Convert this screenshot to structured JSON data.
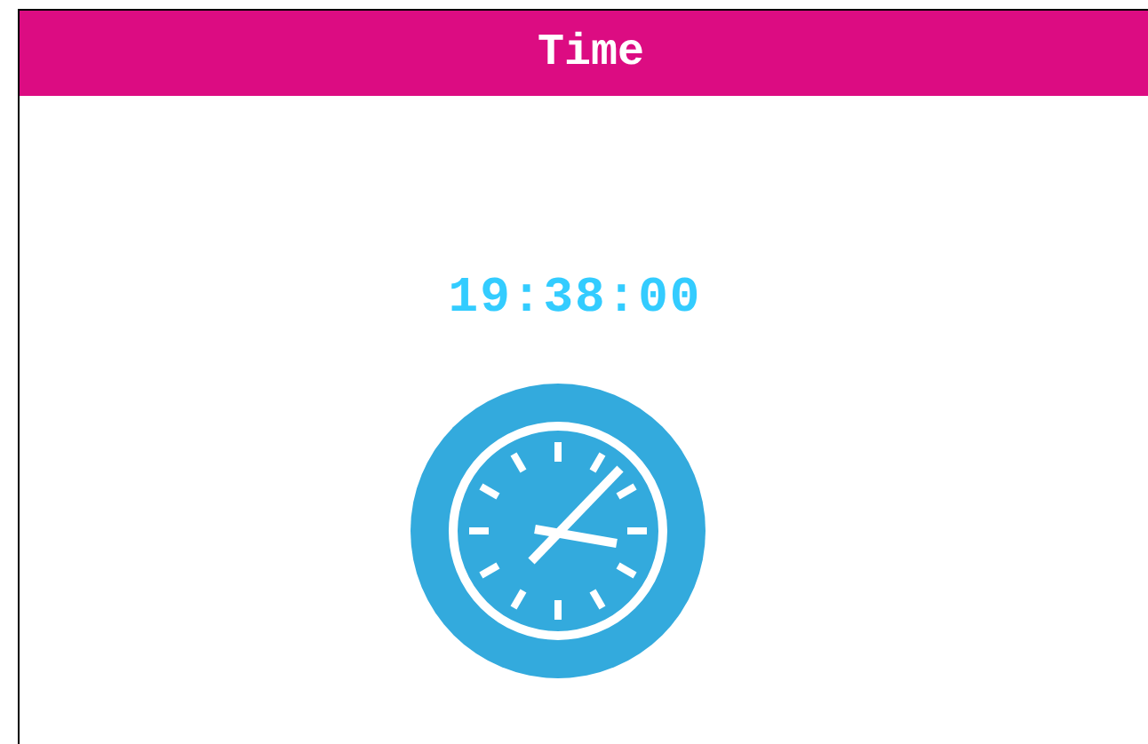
{
  "panel": {
    "title": "Time"
  },
  "clock": {
    "time": "19:38:00"
  }
}
